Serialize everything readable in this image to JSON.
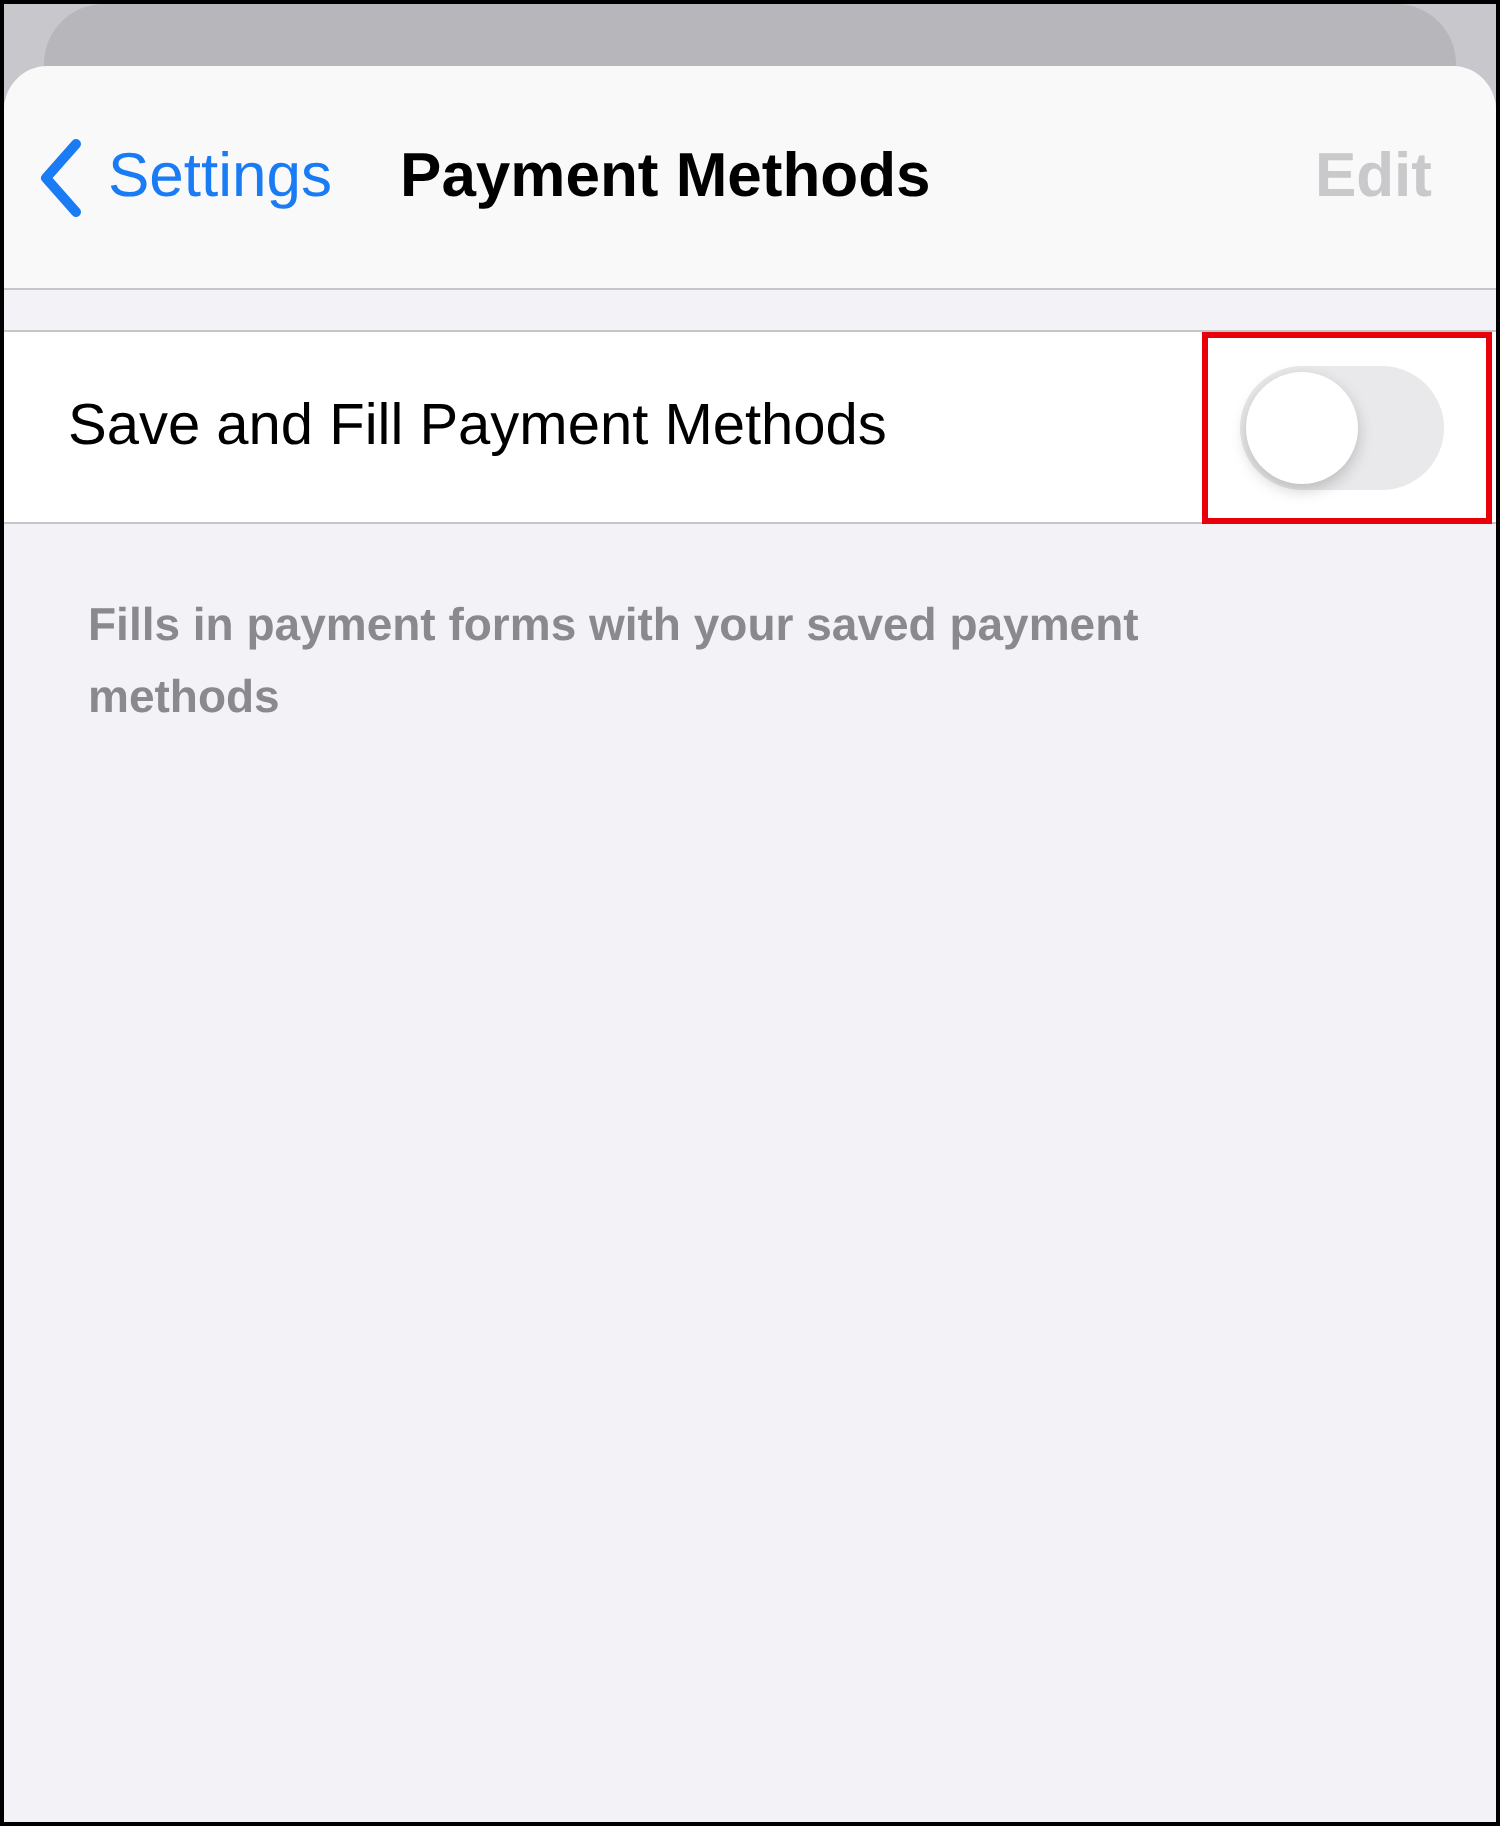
{
  "nav": {
    "back": "Settings",
    "title": "Payment Methods",
    "edit": {
      "label": "Edit",
      "disabled": true
    }
  },
  "rows": [
    {
      "label": "Save and Fill Payment Methods",
      "on": false,
      "highlighted": true
    }
  ],
  "footer": "Fills in payment forms with your saved payment methods"
}
